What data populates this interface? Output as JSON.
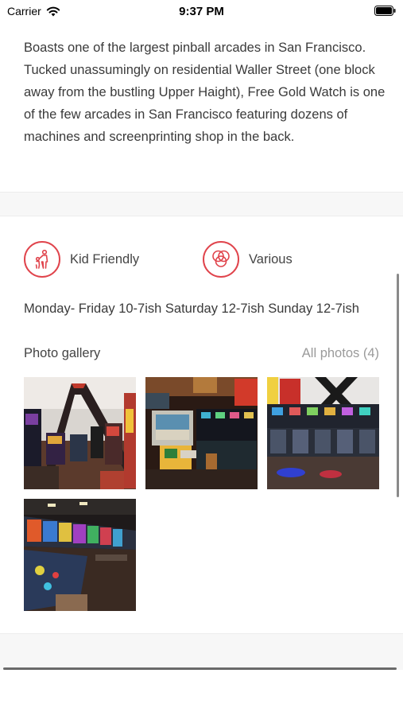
{
  "status_bar": {
    "carrier": "Carrier",
    "time": "9:37 PM",
    "icons": [
      "wifi-icon",
      "battery-icon"
    ]
  },
  "description": "Boasts one of the largest pinball arcades in San Francisco. Tucked unassumingly on residential Waller Street (one block away from the bustling Upper Haight), Free Gold Watch is one of the few arcades in San Francisco featuring dozens of machines and screenprinting shop in the back.",
  "features": [
    {
      "label": "Kid Friendly",
      "icon": "kid-friendly-icon"
    },
    {
      "label": "Various",
      "icon": "various-icon"
    }
  ],
  "hours": "Monday- Friday 10-7ish Saturday 12-7ish Sunday 12-7ish",
  "gallery": {
    "title": "Photo gallery",
    "all_photos_label": "All photos (4)",
    "photos": [
      {
        "name": "gallery-photo-1"
      },
      {
        "name": "gallery-photo-2"
      },
      {
        "name": "gallery-photo-3"
      },
      {
        "name": "gallery-photo-4"
      }
    ]
  },
  "colors": {
    "accent": "#e0444c",
    "muted_text": "#9a9a9a",
    "body_text": "#3a3a3a",
    "separator_band": "#f7f7f7"
  }
}
